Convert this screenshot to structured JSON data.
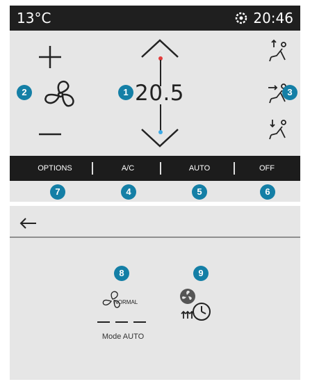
{
  "screen1": {
    "status": {
      "outside_temp": "13°C",
      "time": "20:46",
      "settings_icon": "gear-icon"
    },
    "temperature": {
      "value": "20.5"
    },
    "badges": {
      "temperature": "1",
      "fan": "2",
      "airflow": "3",
      "ac": "4",
      "auto": "5",
      "off": "6",
      "options": "7"
    },
    "bottom_bar": {
      "options": "OPTIONS",
      "ac": "A/C",
      "auto": "AUTO",
      "off": "OFF"
    },
    "colors": {
      "badge": "#147fa6",
      "hot": "#e23b3b",
      "cold": "#3ba9e6",
      "bar": "#1c1c1c",
      "panel": "#e6e6e6"
    }
  },
  "screen2": {
    "badges": {
      "mode": "8",
      "timer": "9"
    },
    "mode_icon_text": "NORMAL",
    "mode_label": "Mode AUTO"
  }
}
